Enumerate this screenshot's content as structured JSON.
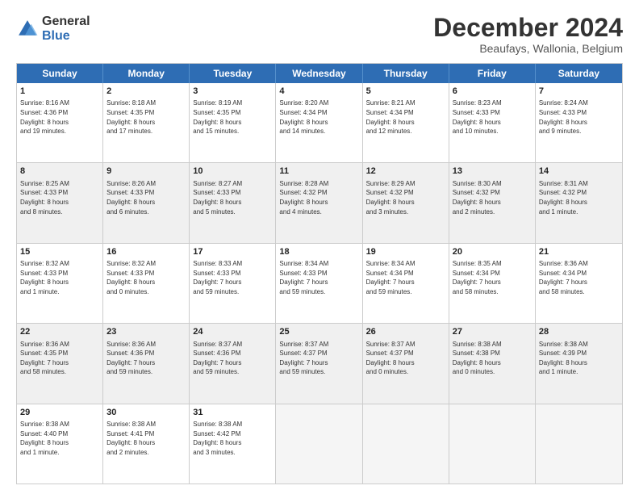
{
  "logo": {
    "general": "General",
    "blue": "Blue"
  },
  "header": {
    "month": "December 2024",
    "location": "Beaufays, Wallonia, Belgium"
  },
  "weekdays": [
    "Sunday",
    "Monday",
    "Tuesday",
    "Wednesday",
    "Thursday",
    "Friday",
    "Saturday"
  ],
  "rows": [
    [
      {
        "day": "1",
        "lines": [
          "Sunrise: 8:16 AM",
          "Sunset: 4:36 PM",
          "Daylight: 8 hours",
          "and 19 minutes."
        ]
      },
      {
        "day": "2",
        "lines": [
          "Sunrise: 8:18 AM",
          "Sunset: 4:35 PM",
          "Daylight: 8 hours",
          "and 17 minutes."
        ]
      },
      {
        "day": "3",
        "lines": [
          "Sunrise: 8:19 AM",
          "Sunset: 4:35 PM",
          "Daylight: 8 hours",
          "and 15 minutes."
        ]
      },
      {
        "day": "4",
        "lines": [
          "Sunrise: 8:20 AM",
          "Sunset: 4:34 PM",
          "Daylight: 8 hours",
          "and 14 minutes."
        ]
      },
      {
        "day": "5",
        "lines": [
          "Sunrise: 8:21 AM",
          "Sunset: 4:34 PM",
          "Daylight: 8 hours",
          "and 12 minutes."
        ]
      },
      {
        "day": "6",
        "lines": [
          "Sunrise: 8:23 AM",
          "Sunset: 4:33 PM",
          "Daylight: 8 hours",
          "and 10 minutes."
        ]
      },
      {
        "day": "7",
        "lines": [
          "Sunrise: 8:24 AM",
          "Sunset: 4:33 PM",
          "Daylight: 8 hours",
          "and 9 minutes."
        ]
      }
    ],
    [
      {
        "day": "8",
        "lines": [
          "Sunrise: 8:25 AM",
          "Sunset: 4:33 PM",
          "Daylight: 8 hours",
          "and 8 minutes."
        ]
      },
      {
        "day": "9",
        "lines": [
          "Sunrise: 8:26 AM",
          "Sunset: 4:33 PM",
          "Daylight: 8 hours",
          "and 6 minutes."
        ]
      },
      {
        "day": "10",
        "lines": [
          "Sunrise: 8:27 AM",
          "Sunset: 4:33 PM",
          "Daylight: 8 hours",
          "and 5 minutes."
        ]
      },
      {
        "day": "11",
        "lines": [
          "Sunrise: 8:28 AM",
          "Sunset: 4:32 PM",
          "Daylight: 8 hours",
          "and 4 minutes."
        ]
      },
      {
        "day": "12",
        "lines": [
          "Sunrise: 8:29 AM",
          "Sunset: 4:32 PM",
          "Daylight: 8 hours",
          "and 3 minutes."
        ]
      },
      {
        "day": "13",
        "lines": [
          "Sunrise: 8:30 AM",
          "Sunset: 4:32 PM",
          "Daylight: 8 hours",
          "and 2 minutes."
        ]
      },
      {
        "day": "14",
        "lines": [
          "Sunrise: 8:31 AM",
          "Sunset: 4:32 PM",
          "Daylight: 8 hours",
          "and 1 minute."
        ]
      }
    ],
    [
      {
        "day": "15",
        "lines": [
          "Sunrise: 8:32 AM",
          "Sunset: 4:33 PM",
          "Daylight: 8 hours",
          "and 1 minute."
        ]
      },
      {
        "day": "16",
        "lines": [
          "Sunrise: 8:32 AM",
          "Sunset: 4:33 PM",
          "Daylight: 8 hours",
          "and 0 minutes."
        ]
      },
      {
        "day": "17",
        "lines": [
          "Sunrise: 8:33 AM",
          "Sunset: 4:33 PM",
          "Daylight: 7 hours",
          "and 59 minutes."
        ]
      },
      {
        "day": "18",
        "lines": [
          "Sunrise: 8:34 AM",
          "Sunset: 4:33 PM",
          "Daylight: 7 hours",
          "and 59 minutes."
        ]
      },
      {
        "day": "19",
        "lines": [
          "Sunrise: 8:34 AM",
          "Sunset: 4:34 PM",
          "Daylight: 7 hours",
          "and 59 minutes."
        ]
      },
      {
        "day": "20",
        "lines": [
          "Sunrise: 8:35 AM",
          "Sunset: 4:34 PM",
          "Daylight: 7 hours",
          "and 58 minutes."
        ]
      },
      {
        "day": "21",
        "lines": [
          "Sunrise: 8:36 AM",
          "Sunset: 4:34 PM",
          "Daylight: 7 hours",
          "and 58 minutes."
        ]
      }
    ],
    [
      {
        "day": "22",
        "lines": [
          "Sunrise: 8:36 AM",
          "Sunset: 4:35 PM",
          "Daylight: 7 hours",
          "and 58 minutes."
        ]
      },
      {
        "day": "23",
        "lines": [
          "Sunrise: 8:36 AM",
          "Sunset: 4:36 PM",
          "Daylight: 7 hours",
          "and 59 minutes."
        ]
      },
      {
        "day": "24",
        "lines": [
          "Sunrise: 8:37 AM",
          "Sunset: 4:36 PM",
          "Daylight: 7 hours",
          "and 59 minutes."
        ]
      },
      {
        "day": "25",
        "lines": [
          "Sunrise: 8:37 AM",
          "Sunset: 4:37 PM",
          "Daylight: 7 hours",
          "and 59 minutes."
        ]
      },
      {
        "day": "26",
        "lines": [
          "Sunrise: 8:37 AM",
          "Sunset: 4:37 PM",
          "Daylight: 8 hours",
          "and 0 minutes."
        ]
      },
      {
        "day": "27",
        "lines": [
          "Sunrise: 8:38 AM",
          "Sunset: 4:38 PM",
          "Daylight: 8 hours",
          "and 0 minutes."
        ]
      },
      {
        "day": "28",
        "lines": [
          "Sunrise: 8:38 AM",
          "Sunset: 4:39 PM",
          "Daylight: 8 hours",
          "and 1 minute."
        ]
      }
    ],
    [
      {
        "day": "29",
        "lines": [
          "Sunrise: 8:38 AM",
          "Sunset: 4:40 PM",
          "Daylight: 8 hours",
          "and 1 minute."
        ]
      },
      {
        "day": "30",
        "lines": [
          "Sunrise: 8:38 AM",
          "Sunset: 4:41 PM",
          "Daylight: 8 hours",
          "and 2 minutes."
        ]
      },
      {
        "day": "31",
        "lines": [
          "Sunrise: 8:38 AM",
          "Sunset: 4:42 PM",
          "Daylight: 8 hours",
          "and 3 minutes."
        ]
      },
      {
        "day": "",
        "lines": []
      },
      {
        "day": "",
        "lines": []
      },
      {
        "day": "",
        "lines": []
      },
      {
        "day": "",
        "lines": []
      }
    ]
  ]
}
